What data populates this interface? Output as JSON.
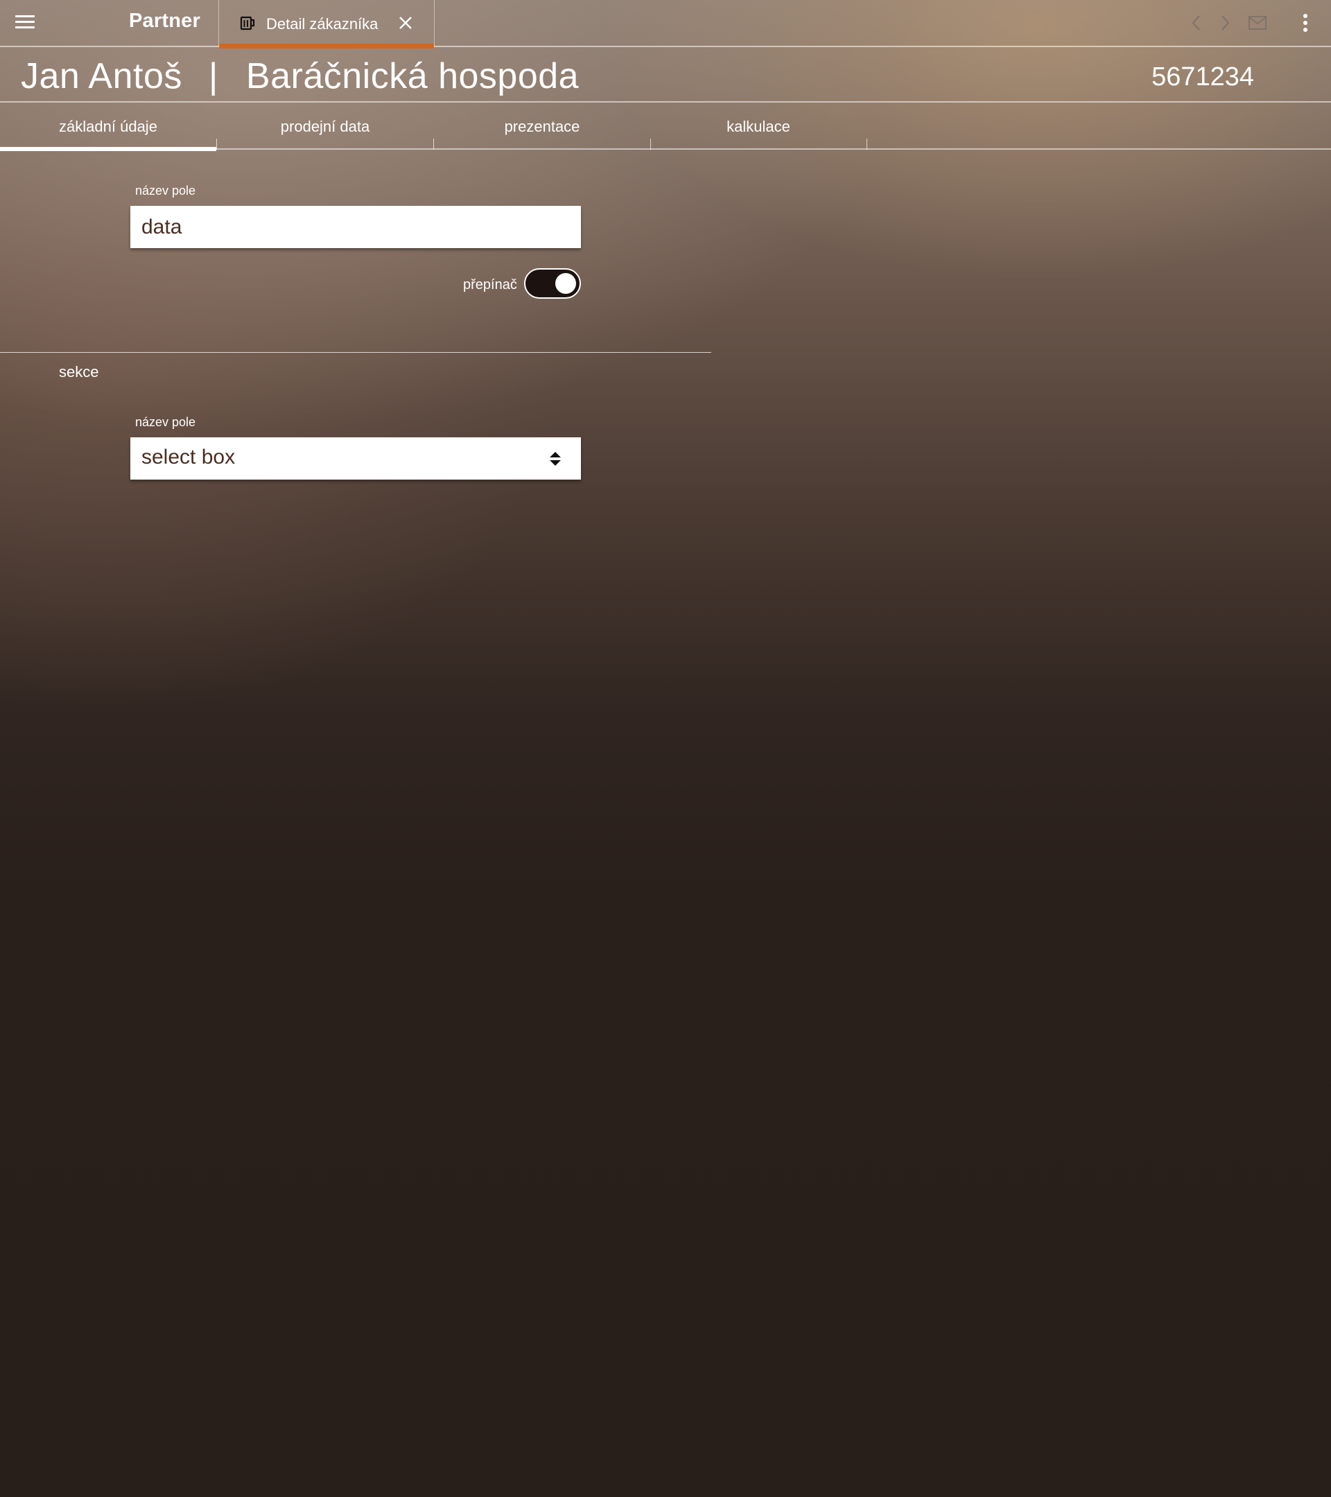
{
  "app": {
    "brand": "Partner",
    "open_tab": {
      "label": "Detail zákazníka",
      "icon": "beer-mug-icon"
    }
  },
  "header": {
    "contact_name": "Jan Antoš",
    "separator": "|",
    "company_name": "Baráčnická hospoda",
    "customer_id": "5671234"
  },
  "tabs": [
    {
      "label": "základní údaje",
      "active": true
    },
    {
      "label": "prodejní data",
      "active": false
    },
    {
      "label": "prezentace",
      "active": false
    },
    {
      "label": "kalkulace",
      "active": false
    }
  ],
  "form": {
    "field1": {
      "label": "název pole",
      "value": "data"
    },
    "toggle": {
      "label": "přepínač",
      "on": true
    },
    "section": {
      "title": "sekce"
    },
    "field2": {
      "label": "název pole",
      "selected": "select box"
    }
  },
  "toolbar_icons": [
    "menu-icon",
    "chevron-left-icon",
    "chevron-right-icon",
    "mail-icon",
    "more-vertical-icon"
  ],
  "colors": {
    "accent": "#d4661e",
    "input_text": "#4a2e22",
    "toggle_track": "#1c1310"
  }
}
